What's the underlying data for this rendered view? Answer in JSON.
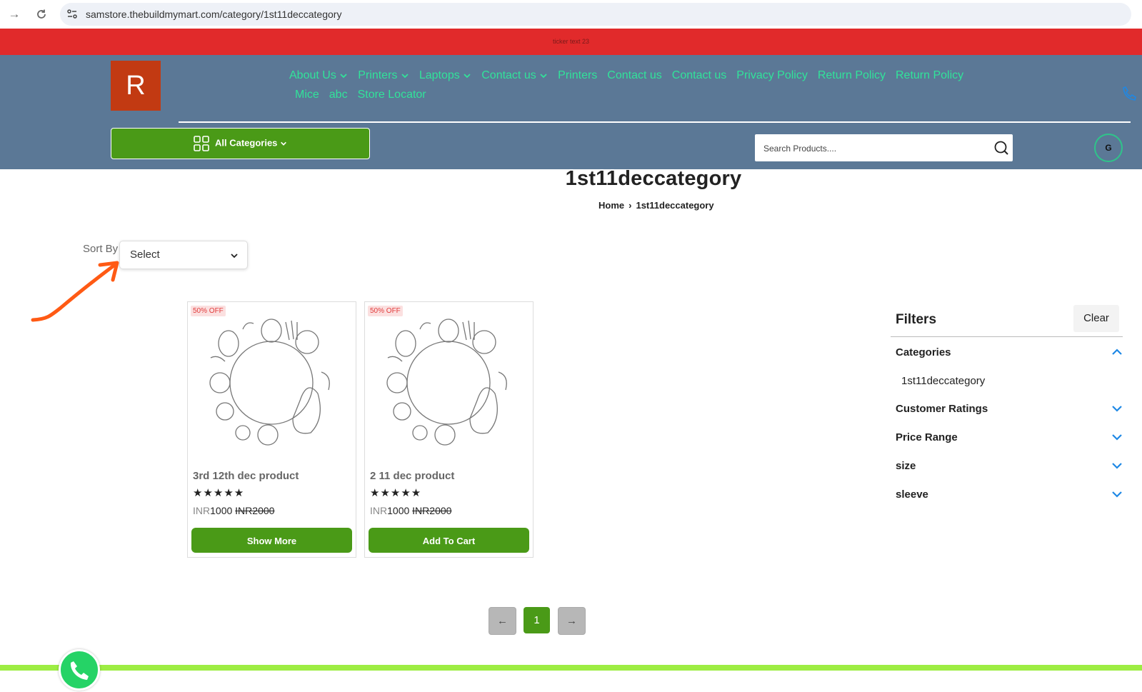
{
  "browser": {
    "url": "samstore.thebuildmymart.com/category/1st11deccategory"
  },
  "ticker": {
    "text": "ticker text 23"
  },
  "header": {
    "logo_letter": "R",
    "menu_row1": [
      {
        "label": "About Us",
        "dropdown": true
      },
      {
        "label": "Printers",
        "dropdown": true
      },
      {
        "label": "Laptops",
        "dropdown": true
      },
      {
        "label": "Contact us",
        "dropdown": true
      },
      {
        "label": "Printers",
        "dropdown": false
      },
      {
        "label": "Contact us",
        "dropdown": false
      },
      {
        "label": "Contact us",
        "dropdown": false
      },
      {
        "label": "Privacy Policy",
        "dropdown": false
      },
      {
        "label": "Return Policy",
        "dropdown": false
      },
      {
        "label": "Return Policy",
        "dropdown": false
      }
    ],
    "menu_row2": [
      {
        "label": "Mice"
      },
      {
        "label": "abc"
      },
      {
        "label": "Store Locator"
      }
    ],
    "all_categories_label": "All Categories",
    "search_placeholder": "Search Products....",
    "avatar_letter": "G"
  },
  "page": {
    "title": "1st11deccategory",
    "breadcrumb": {
      "home": "Home",
      "current": "1st11deccategory"
    }
  },
  "sort": {
    "label": "Sort By",
    "value": "Select"
  },
  "products": [
    {
      "badge": "50% OFF",
      "name": "3rd 12th dec product",
      "stars": "★★★★★",
      "currency": "INR",
      "price": "1000",
      "old_price": "INR2000",
      "button": "Show More"
    },
    {
      "badge": "50% OFF",
      "name": "2 11 dec product",
      "stars": "★★★★★",
      "currency": "INR",
      "price": "1000",
      "old_price": "INR2000",
      "button": "Add To Cart"
    }
  ],
  "filters": {
    "title": "Filters",
    "clear_label": "Clear",
    "sections": [
      {
        "label": "Categories",
        "expanded": true
      },
      {
        "label": "Customer Ratings",
        "expanded": false
      },
      {
        "label": "Price Range",
        "expanded": false
      },
      {
        "label": "size",
        "expanded": false
      },
      {
        "label": "sleeve",
        "expanded": false
      }
    ],
    "category_options": [
      "1st11deccategory"
    ]
  },
  "pagination": {
    "prev": "←",
    "current": "1",
    "next": "→"
  },
  "colors": {
    "ticker": "#e12a2b",
    "header": "#5b7896",
    "menu_text": "#31e39a",
    "primary_green": "#4a9a17",
    "logo": "#c23a12",
    "filter_chevron": "#1e88e5",
    "footer": "#9ded43",
    "annotation_arrow": "#ff5a14"
  }
}
